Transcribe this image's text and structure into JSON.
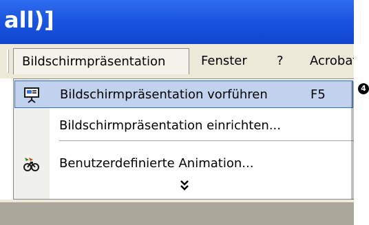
{
  "window": {
    "title_fragment": "all)]"
  },
  "menubar": {
    "items": [
      {
        "label": "Bildschirmpräsentation",
        "state": "open"
      },
      {
        "label": "Fenster"
      },
      {
        "label": "?"
      },
      {
        "label": "Acrobat"
      }
    ]
  },
  "dropdown": {
    "items": [
      {
        "label": "Bildschirmpräsentation vorführen",
        "shortcut": "F5",
        "icon": "projector-screen-icon",
        "highlighted": true
      },
      {
        "label": "Bildschirmpräsentation einrichten...",
        "icon": null
      },
      {
        "label": "Benutzerdefinierte Animation...",
        "icon": "custom-animation-icon"
      }
    ],
    "expand": "expand-arrows-icon"
  },
  "callout": {
    "label": "4"
  },
  "colors": {
    "titlebar": "#1a56e0",
    "menubar": "#ece9d8",
    "highlight_fill": "#c0d2ee",
    "highlight_border": "#3169c6"
  }
}
